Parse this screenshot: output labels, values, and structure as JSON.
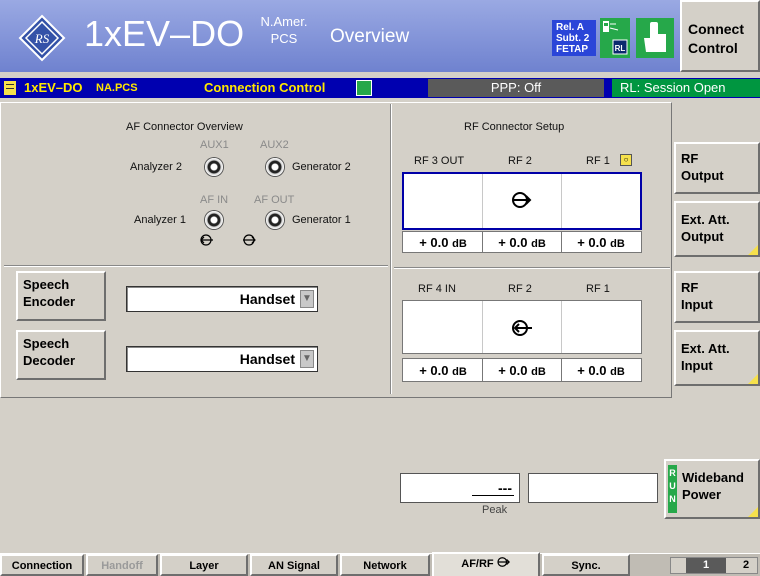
{
  "header": {
    "standard": "1xEV–DO",
    "band_line1": "N.Amer.",
    "band_line2": "PCS",
    "view": "Overview",
    "release_line1": "Rel. A",
    "release_line2": "Subt. 2",
    "release_line3": "FETAP",
    "connect_control_line1": "Connect",
    "connect_control_line2": "Control"
  },
  "status_bar": {
    "standard": "1xEV–DO",
    "band": "NA.PCS",
    "menu": "Connection Control",
    "ppp": "PPP: Off",
    "reverse_link": "RL: Session Open"
  },
  "af_overview": {
    "title": "AF Connector Overview",
    "aux1": "AUX1",
    "aux2": "AUX2",
    "analyzer2": "Analyzer 2",
    "generator2": "Generator 2",
    "af_in": "AF IN",
    "af_out": "AF OUT",
    "analyzer1": "Analyzer 1",
    "generator1": "Generator 1"
  },
  "speech": {
    "encoder_label_line1": "Speech",
    "encoder_label_line2": "Encoder",
    "encoder_value": "Handset",
    "decoder_label_line1": "Speech",
    "decoder_label_line2": "Decoder",
    "decoder_value": "Handset"
  },
  "rf_setup": {
    "title": "RF Connector Setup",
    "out_columns": [
      "RF 3 OUT",
      "RF 2",
      "RF 1"
    ],
    "out_atten": [
      "+ 0.0",
      "+ 0.0",
      "+ 0.0"
    ],
    "in_columns": [
      "RF 4 IN",
      "RF 2",
      "RF 1"
    ],
    "in_atten": [
      "+ 0.0",
      "+ 0.0",
      "+ 0.0"
    ],
    "unit": "dB"
  },
  "softkeys": {
    "rf_output": [
      "RF",
      "Output"
    ],
    "ext_att_output": [
      "Ext. Att.",
      "Output"
    ],
    "rf_input": [
      "RF",
      "Input"
    ],
    "ext_att_input": [
      "Ext. Att.",
      "Input"
    ],
    "wideband_power": [
      "Wideband",
      "Power"
    ],
    "run_letters": [
      "R",
      "U",
      "N"
    ]
  },
  "power": {
    "peak_value": "---",
    "peak_label": "Peak"
  },
  "tabs": [
    "Connection",
    "Handoff",
    "Layer",
    "AN Signal",
    "Network",
    "AF/RF",
    "Sync."
  ],
  "pages": [
    "1",
    "2"
  ],
  "colors": {
    "header_blue": "#7d8fdb",
    "status_bar": "#0000b0",
    "status_text": "#ffe800",
    "highlight": "#f6e14c",
    "selected_frame": "#0000a8"
  }
}
